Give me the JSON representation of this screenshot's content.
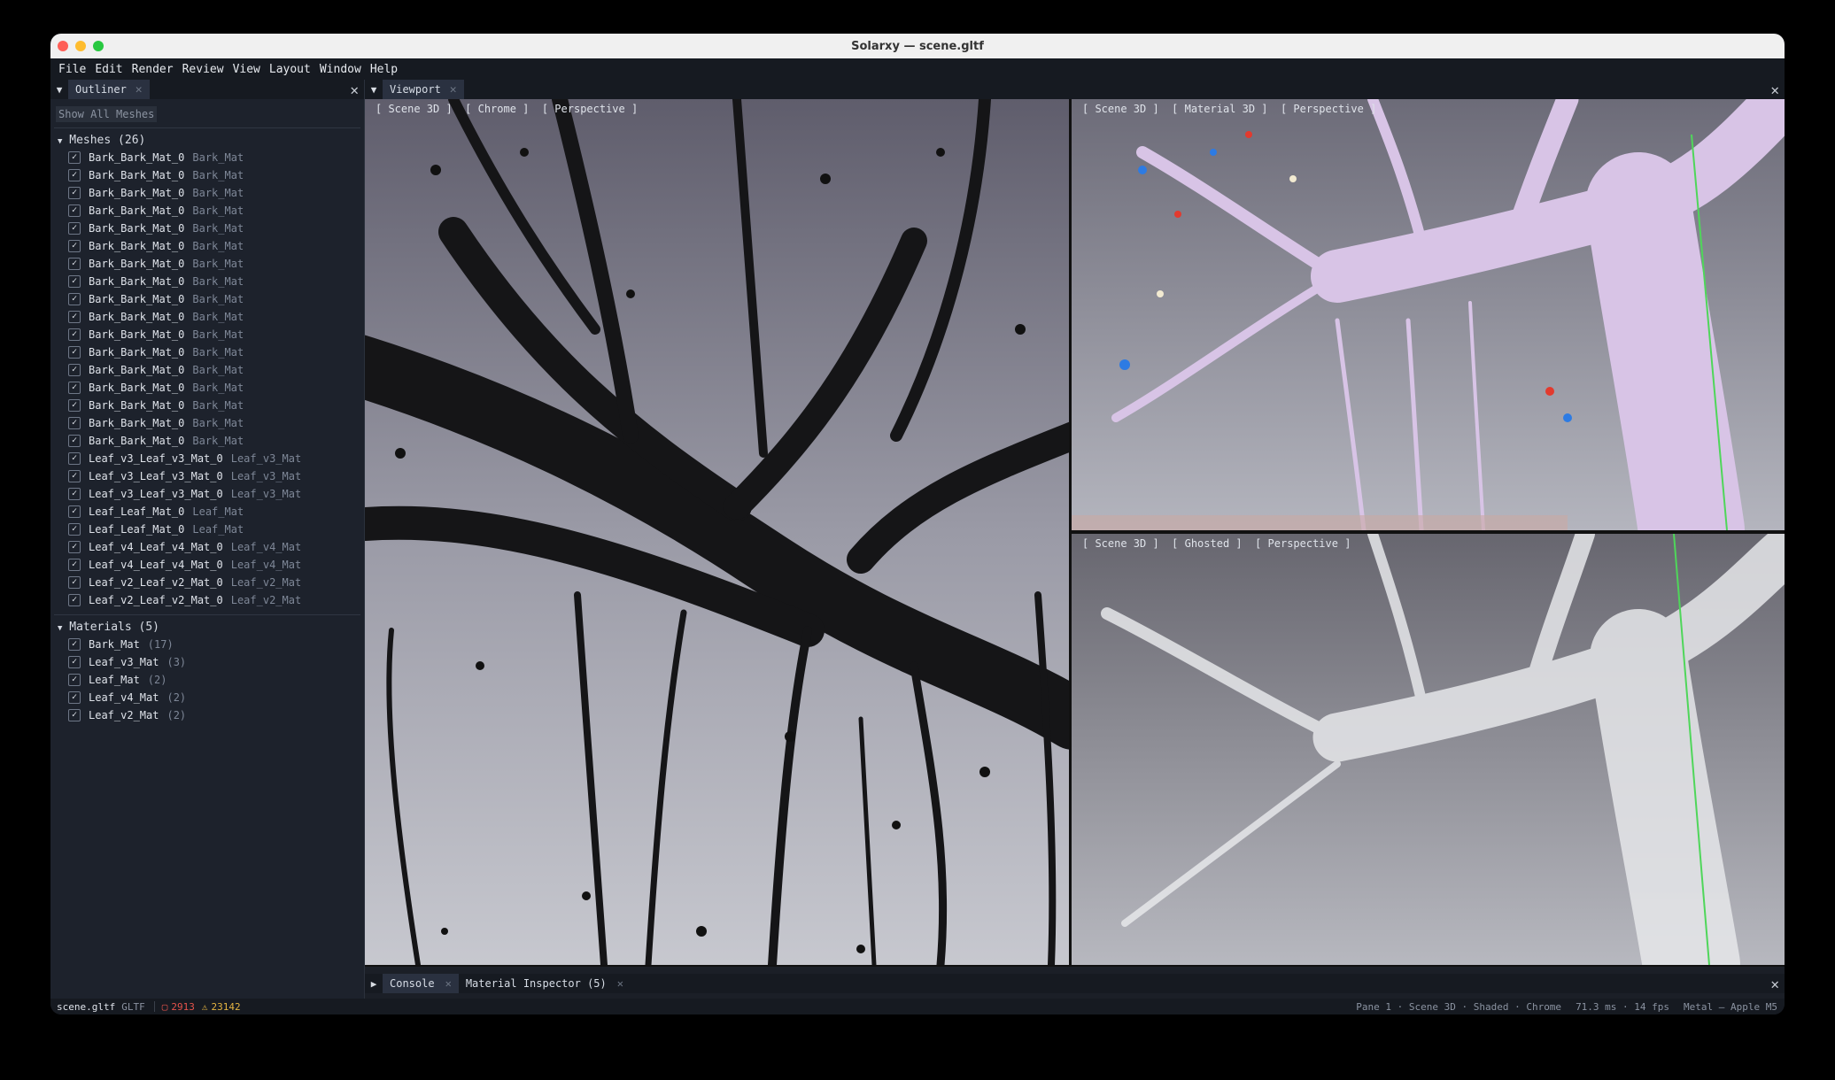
{
  "window": {
    "title": "Solarxy — scene.gltf"
  },
  "menu": [
    "File",
    "Edit",
    "Render",
    "Review",
    "View",
    "Layout",
    "Window",
    "Help"
  ],
  "outliner": {
    "tab_label": "Outliner",
    "show_all_label": "Show All Meshes",
    "meshes_title": "Meshes (26)",
    "meshes": [
      {
        "name": "Bark_Bark_Mat_0",
        "mat": "Bark_Mat"
      },
      {
        "name": "Bark_Bark_Mat_0",
        "mat": "Bark_Mat"
      },
      {
        "name": "Bark_Bark_Mat_0",
        "mat": "Bark_Mat"
      },
      {
        "name": "Bark_Bark_Mat_0",
        "mat": "Bark_Mat"
      },
      {
        "name": "Bark_Bark_Mat_0",
        "mat": "Bark_Mat"
      },
      {
        "name": "Bark_Bark_Mat_0",
        "mat": "Bark_Mat"
      },
      {
        "name": "Bark_Bark_Mat_0",
        "mat": "Bark_Mat"
      },
      {
        "name": "Bark_Bark_Mat_0",
        "mat": "Bark_Mat"
      },
      {
        "name": "Bark_Bark_Mat_0",
        "mat": "Bark_Mat"
      },
      {
        "name": "Bark_Bark_Mat_0",
        "mat": "Bark_Mat"
      },
      {
        "name": "Bark_Bark_Mat_0",
        "mat": "Bark_Mat"
      },
      {
        "name": "Bark_Bark_Mat_0",
        "mat": "Bark_Mat"
      },
      {
        "name": "Bark_Bark_Mat_0",
        "mat": "Bark_Mat"
      },
      {
        "name": "Bark_Bark_Mat_0",
        "mat": "Bark_Mat"
      },
      {
        "name": "Bark_Bark_Mat_0",
        "mat": "Bark_Mat"
      },
      {
        "name": "Bark_Bark_Mat_0",
        "mat": "Bark_Mat"
      },
      {
        "name": "Bark_Bark_Mat_0",
        "mat": "Bark_Mat"
      },
      {
        "name": "Leaf_v3_Leaf_v3_Mat_0",
        "mat": "Leaf_v3_Mat"
      },
      {
        "name": "Leaf_v3_Leaf_v3_Mat_0",
        "mat": "Leaf_v3_Mat"
      },
      {
        "name": "Leaf_v3_Leaf_v3_Mat_0",
        "mat": "Leaf_v3_Mat"
      },
      {
        "name": "Leaf_Leaf_Mat_0",
        "mat": "Leaf_Mat"
      },
      {
        "name": "Leaf_Leaf_Mat_0",
        "mat": "Leaf_Mat"
      },
      {
        "name": "Leaf_v4_Leaf_v4_Mat_0",
        "mat": "Leaf_v4_Mat"
      },
      {
        "name": "Leaf_v4_Leaf_v4_Mat_0",
        "mat": "Leaf_v4_Mat"
      },
      {
        "name": "Leaf_v2_Leaf_v2_Mat_0",
        "mat": "Leaf_v2_Mat"
      },
      {
        "name": "Leaf_v2_Leaf_v2_Mat_0",
        "mat": "Leaf_v2_Mat"
      }
    ],
    "materials_title": "Materials (5)",
    "materials": [
      {
        "name": "Bark_Mat",
        "count": "(17)"
      },
      {
        "name": "Leaf_v3_Mat",
        "count": "(3)"
      },
      {
        "name": "Leaf_Mat",
        "count": "(2)"
      },
      {
        "name": "Leaf_v4_Mat",
        "count": "(2)"
      },
      {
        "name": "Leaf_v2_Mat",
        "count": "(2)"
      }
    ]
  },
  "viewport": {
    "tab_label": "Viewport",
    "panes": [
      {
        "label": "[ Scene 3D ]  [ Chrome ]  [ Perspective ]"
      },
      {
        "label": "[ Scene 3D ]  [ Material 3D ]  [ Perspective ]"
      },
      {
        "label": "[ Scene 3D ]  [ Ghosted ]  [ Perspective ]"
      }
    ]
  },
  "bottom_tabs": {
    "console": "Console",
    "inspector": "Material Inspector (5)"
  },
  "status": {
    "file": "scene.gltf",
    "format": "GLTF",
    "errors": "2913",
    "warnings": "23142",
    "pane_info": "Pane 1 · Scene 3D · Shaded · Chrome",
    "timing": "71.3 ms · 14 fps",
    "backend": "Metal — Apple M5"
  },
  "colors": {
    "accent_tab": "#2a3140",
    "active_pane_border": "#b9955a",
    "error": "#e5534b",
    "warning": "#e3b341"
  }
}
